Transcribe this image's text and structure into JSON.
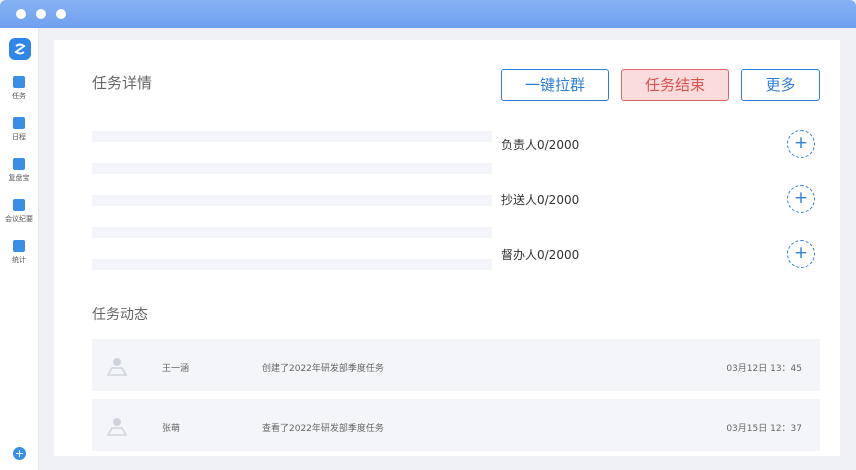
{
  "sidebar": {
    "items": [
      {
        "label": "任务",
        "icon": "task-icon"
      },
      {
        "label": "日程",
        "icon": "calendar-icon"
      },
      {
        "label": "复盘宝",
        "icon": "review-icon"
      },
      {
        "label": "会议纪要",
        "icon": "minutes-icon"
      },
      {
        "label": "统计",
        "icon": "stats-icon"
      }
    ]
  },
  "detail": {
    "title": "任务详情",
    "buttons": {
      "group": "一键拉群",
      "end": "任务结束",
      "more": "更多"
    },
    "roles": [
      {
        "label": "负责人0/2000"
      },
      {
        "label": "抄送人0/2000"
      },
      {
        "label": "督办人0/2000"
      }
    ],
    "add_symbol": "+"
  },
  "activity": {
    "title": "任务动态",
    "rows": [
      {
        "name": "王一涵",
        "desc": "创建了2022年研发部季度任务",
        "time": "03月12日  13：45"
      },
      {
        "name": "张萌",
        "desc": "查看了2022年研发部季度任务",
        "time": "03月15日  12：37"
      }
    ]
  },
  "colors": {
    "accent": "#2f7fd8",
    "danger_bg": "#fbdcdc",
    "danger_text": "#d9534f",
    "titlebar": "#7aa9f2"
  }
}
